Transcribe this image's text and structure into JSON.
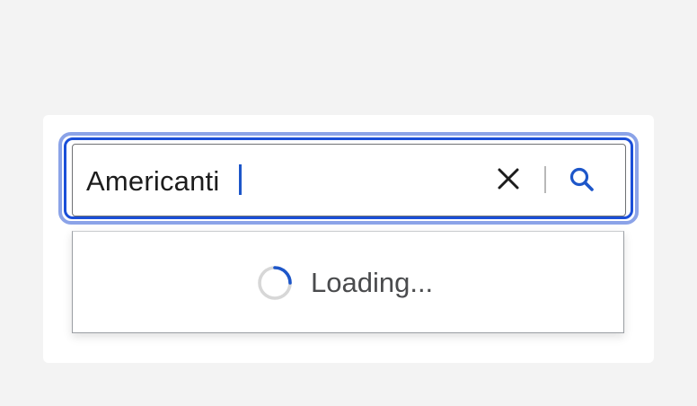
{
  "search": {
    "value": "Americanti",
    "loading_text": "Loading..."
  },
  "icons": {
    "clear": "close-icon",
    "search": "search-icon",
    "spinner": "spinner-icon"
  },
  "colors": {
    "page_bg": "#f3f3f3",
    "focus_ring": "#8ba3e8",
    "focus_border": "#1b4fd8",
    "accent": "#1d56c9",
    "text": "#1c1c1c",
    "muted_text": "#4a4b4d"
  }
}
